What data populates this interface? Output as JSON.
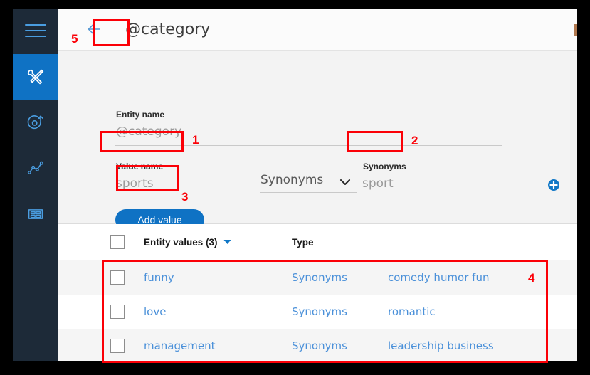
{
  "window": {
    "title": "@category"
  },
  "sidebar": {
    "items": [
      {
        "id": "menu",
        "icon": "hamburger-menu-icon",
        "label": "Menu",
        "active": false
      },
      {
        "id": "build",
        "icon": "tools-icon",
        "label": "Build",
        "active": true
      },
      {
        "id": "deploy",
        "icon": "deploy-target-icon",
        "label": "Deploy",
        "active": false
      },
      {
        "id": "improve",
        "icon": "analytics-line-chart-icon",
        "label": "Improve",
        "active": false
      },
      {
        "id": "apps",
        "icon": "grid-apps-icon",
        "label": "Apps",
        "active": false
      }
    ]
  },
  "header": {
    "back_icon": "arrow-left-icon",
    "title": "@category"
  },
  "form": {
    "entity_name_label": "Entity name",
    "entity_name_value": "@category",
    "value_name_label": "Value name",
    "value_name_value": "sports",
    "type_select_value": "Synonyms",
    "type_caret_icon": "chevron-down-icon",
    "synonyms_label": "Synonyms",
    "synonyms_value": "sport",
    "add_synonym_icon": "plus-circle-icon",
    "add_value_label": "Add value"
  },
  "table": {
    "headers": {
      "name": "Entity values (3)",
      "sort_icon": "caret-down-icon",
      "type": "Type",
      "synonyms": ""
    },
    "rows": [
      {
        "name": "funny",
        "type": "Synonyms",
        "synonyms": "comedy humor fun"
      },
      {
        "name": "love",
        "type": "Synonyms",
        "synonyms": "romantic"
      },
      {
        "name": "management",
        "type": "Synonyms",
        "synonyms": "leadership business"
      }
    ]
  },
  "annotations": {
    "markers": [
      {
        "id": "1",
        "label": "1",
        "target": "value-name-input"
      },
      {
        "id": "2",
        "label": "2",
        "target": "synonyms-input"
      },
      {
        "id": "3",
        "label": "3",
        "target": "add-value-button"
      },
      {
        "id": "4",
        "label": "4",
        "target": "entity-values-rows"
      },
      {
        "id": "5",
        "label": "5",
        "target": "back-button"
      }
    ]
  },
  "colors": {
    "accent_blue": "#0f72c4",
    "link_blue": "#4a90d9",
    "rail_dark": "#1d2a38",
    "annotation_red": "#fb0007",
    "panel_grey": "#f3f3f3"
  }
}
